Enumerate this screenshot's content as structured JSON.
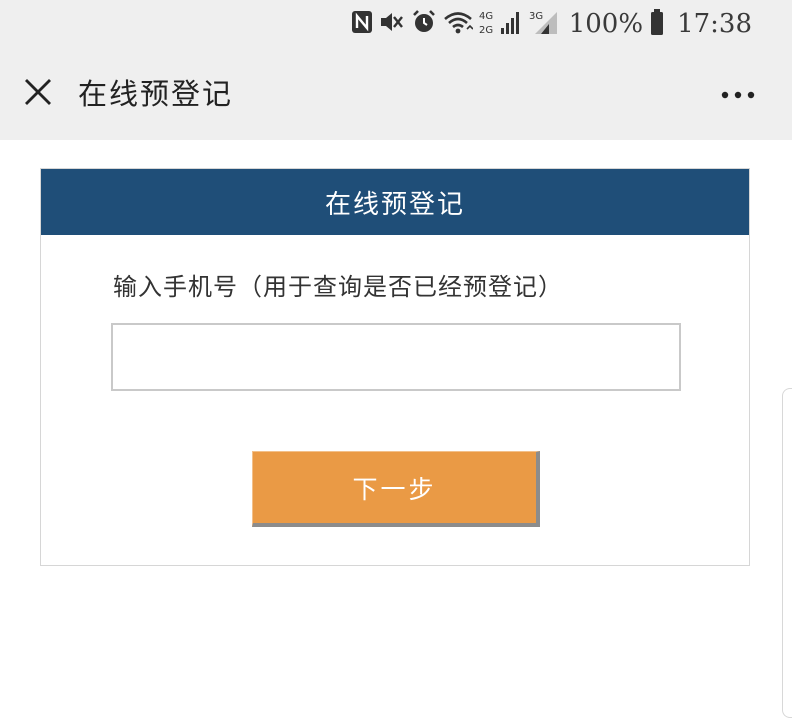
{
  "status_bar": {
    "battery_percent": "100%",
    "time": "17:38",
    "network_top": "4G",
    "network_bottom": "2G",
    "network_alt": "3G",
    "icons": [
      "nfc-icon",
      "mute-icon",
      "alarm-icon",
      "wifi-icon",
      "signal-icon",
      "signal-icon",
      "battery-icon"
    ]
  },
  "header": {
    "title": "在线预登记",
    "close_icon": "close-icon",
    "more_icon": "more-icon"
  },
  "card": {
    "title": "在线预登记",
    "phone_label": "输入手机号（用于查询是否已经预登记）",
    "phone_value": "",
    "phone_placeholder": "",
    "next_label": "下一步"
  },
  "colors": {
    "header_bg": "#efefef",
    "card_header_bg": "#1f4e78",
    "button_bg": "#ea9a45",
    "button_text": "#ffffff"
  }
}
